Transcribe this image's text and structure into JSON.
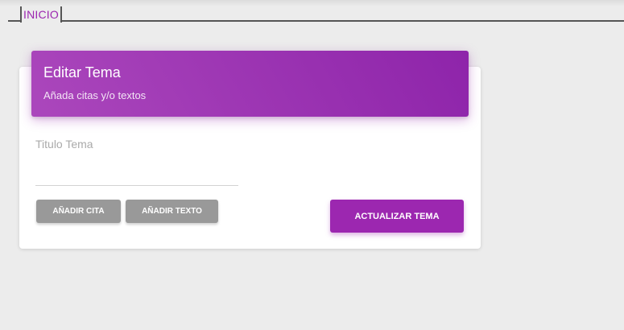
{
  "nav": {
    "tab_label": "INICIO"
  },
  "card": {
    "title": "Editar Tema",
    "subtitle": "Añada citas y/o textos",
    "field": {
      "label": "Titulo Tema",
      "value": ""
    },
    "buttons": {
      "add_quote": "AÑADIR CITA",
      "add_text": "AÑADIR TEXTO",
      "update": "ACTUALIZAR TEMA"
    }
  },
  "colors": {
    "accent": "#9c27b0",
    "secondary_button": "#999999",
    "background": "#ececec"
  }
}
